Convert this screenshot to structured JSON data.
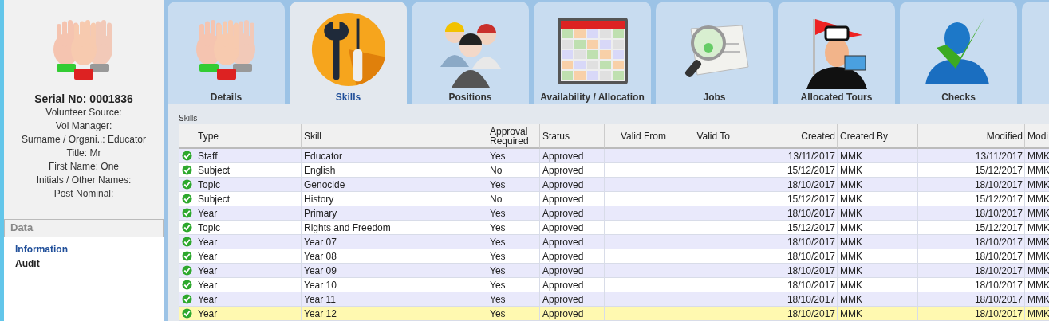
{
  "sidebar": {
    "serial": "Serial No: 0001836",
    "fields": [
      "Volunteer Source:",
      "Vol Manager:",
      "Surname / Organi..: Educator",
      "Title: Mr",
      "First Name: One",
      "Initials / Other Names:",
      "Post Nominal:"
    ],
    "section": "Data",
    "links": [
      {
        "label": "Information",
        "selected": true
      },
      {
        "label": "Audit",
        "selected": false
      }
    ]
  },
  "tabs": [
    {
      "label": "Details",
      "selected": false
    },
    {
      "label": "Skills",
      "selected": true
    },
    {
      "label": "Positions",
      "selected": false
    },
    {
      "label": "Availability / Allocation",
      "selected": false
    },
    {
      "label": "Jobs",
      "selected": false
    },
    {
      "label": "Allocated Tours",
      "selected": false
    },
    {
      "label": "Checks",
      "selected": false
    }
  ],
  "panel_title": "Skills",
  "table": {
    "columns": [
      "Type",
      "Skill",
      "Approval Required",
      "Status",
      "Valid From",
      "Valid To",
      "Created",
      "Created By",
      "Modified",
      "Modi"
    ],
    "rows": [
      {
        "cells": [
          "Staff",
          "Educator",
          "Yes",
          "Approved",
          "",
          "",
          "13/11/2017",
          "MMK",
          "13/11/2017",
          "MMK"
        ],
        "selected": false
      },
      {
        "cells": [
          "Subject",
          "English",
          "No",
          "Approved",
          "",
          "",
          "15/12/2017",
          "MMK",
          "15/12/2017",
          "MMK"
        ],
        "selected": false
      },
      {
        "cells": [
          "Topic",
          "Genocide",
          "Yes",
          "Approved",
          "",
          "",
          "18/10/2017",
          "MMK",
          "18/10/2017",
          "MMK"
        ],
        "selected": false
      },
      {
        "cells": [
          "Subject",
          "History",
          "No",
          "Approved",
          "",
          "",
          "15/12/2017",
          "MMK",
          "15/12/2017",
          "MMK"
        ],
        "selected": false
      },
      {
        "cells": [
          "Year",
          "Primary",
          "Yes",
          "Approved",
          "",
          "",
          "18/10/2017",
          "MMK",
          "18/10/2017",
          "MMK"
        ],
        "selected": false
      },
      {
        "cells": [
          "Topic",
          "Rights and Freedom",
          "Yes",
          "Approved",
          "",
          "",
          "15/12/2017",
          "MMK",
          "15/12/2017",
          "MMK"
        ],
        "selected": false
      },
      {
        "cells": [
          "Year",
          "Year 07",
          "Yes",
          "Approved",
          "",
          "",
          "18/10/2017",
          "MMK",
          "18/10/2017",
          "MMK"
        ],
        "selected": false
      },
      {
        "cells": [
          "Year",
          "Year 08",
          "Yes",
          "Approved",
          "",
          "",
          "18/10/2017",
          "MMK",
          "18/10/2017",
          "MMK"
        ],
        "selected": false
      },
      {
        "cells": [
          "Year",
          "Year 09",
          "Yes",
          "Approved",
          "",
          "",
          "18/10/2017",
          "MMK",
          "18/10/2017",
          "MMK"
        ],
        "selected": false
      },
      {
        "cells": [
          "Year",
          "Year 10",
          "Yes",
          "Approved",
          "",
          "",
          "18/10/2017",
          "MMK",
          "18/10/2017",
          "MMK"
        ],
        "selected": false
      },
      {
        "cells": [
          "Year",
          "Year 11",
          "Yes",
          "Approved",
          "",
          "",
          "18/10/2017",
          "MMK",
          "18/10/2017",
          "MMK"
        ],
        "selected": false
      },
      {
        "cells": [
          "Year",
          "Year 12",
          "Yes",
          "Approved",
          "",
          "",
          "18/10/2017",
          "MMK",
          "18/10/2017",
          "MMK"
        ],
        "selected": true
      }
    ]
  }
}
